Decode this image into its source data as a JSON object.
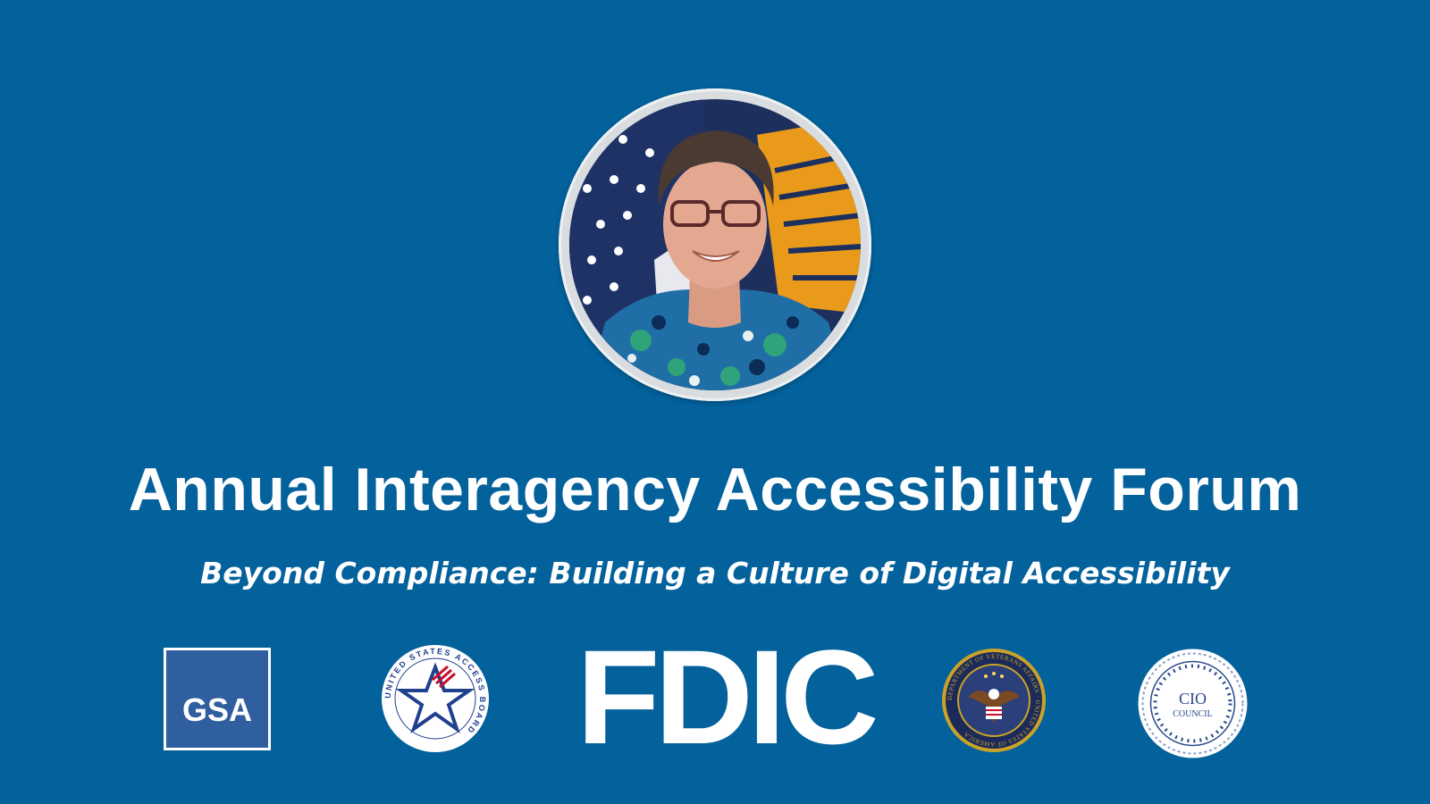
{
  "title": "Annual Interagency Accessibility Forum",
  "subtitle": "Beyond Compliance: Building a Culture of Digital Accessibility",
  "portrait": {
    "subject": "speaker-photo"
  },
  "logos": {
    "gsa": {
      "text": "GSA"
    },
    "access_board": {
      "ring_text": "UNITED STATES ACCESS BOARD"
    },
    "fdic": {
      "text": "FDIC"
    },
    "va": {
      "ring_text": "DEPARTMENT OF VETERANS AFFAIRS · UNITED STATES OF AMERICA"
    },
    "cio": {
      "line1": "CIO",
      "line2": "COUNCIL"
    }
  },
  "colors": {
    "background": "#03619c",
    "text": "#ffffff",
    "gsa_blue": "#2f5f9e",
    "access_red": "#c8102e",
    "access_blue": "#1f3f8f",
    "va_navy": "#1b2a5b",
    "va_gold": "#c9a227"
  }
}
